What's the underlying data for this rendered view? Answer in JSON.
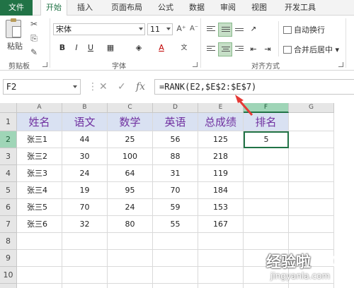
{
  "ribbon_tabs": [
    "文件",
    "开始",
    "插入",
    "页面布局",
    "公式",
    "数据",
    "审阅",
    "视图",
    "开发工具"
  ],
  "active_tab": "开始",
  "clipboard": {
    "paste_label": "粘贴",
    "group_label": "剪贴板"
  },
  "font": {
    "family": "宋体",
    "size": "11",
    "group_label": "字体",
    "bold": "B",
    "italic": "I",
    "underline": "U"
  },
  "alignment": {
    "wrap_label": "自动换行",
    "merge_label": "合并后居中",
    "group_label": "对齐方式"
  },
  "formula_bar": {
    "name_box": "F2",
    "fx": "fx",
    "formula": "=RANK(E2,$E$2:$E$7)"
  },
  "grid": {
    "column_headers": [
      "A",
      "B",
      "C",
      "D",
      "E",
      "F",
      "G"
    ],
    "selected_column": "F",
    "row_headers": [
      "1",
      "2",
      "3",
      "4",
      "5",
      "6",
      "7",
      "8",
      "9",
      "10",
      "11"
    ],
    "selected_row": "2",
    "selected_cell": "F2",
    "header_row": [
      "姓名",
      "语文",
      "数学",
      "英语",
      "总成绩",
      "排名"
    ],
    "rows": [
      [
        "张三1",
        "44",
        "25",
        "56",
        "125",
        "5"
      ],
      [
        "张三2",
        "30",
        "100",
        "88",
        "218",
        ""
      ],
      [
        "张三3",
        "24",
        "64",
        "31",
        "119",
        ""
      ],
      [
        "张三4",
        "19",
        "95",
        "70",
        "184",
        ""
      ],
      [
        "张三5",
        "70",
        "24",
        "59",
        "153",
        ""
      ],
      [
        "张三6",
        "32",
        "80",
        "55",
        "167",
        ""
      ]
    ],
    "header_fill": "#d9e1f2",
    "header_text_color": "#7030a0"
  },
  "annotation": {
    "arrow_color": "#e53935"
  },
  "watermark": {
    "title": "经验啦",
    "url": "jingyanla.com"
  },
  "colors": {
    "accent": "#217346"
  }
}
